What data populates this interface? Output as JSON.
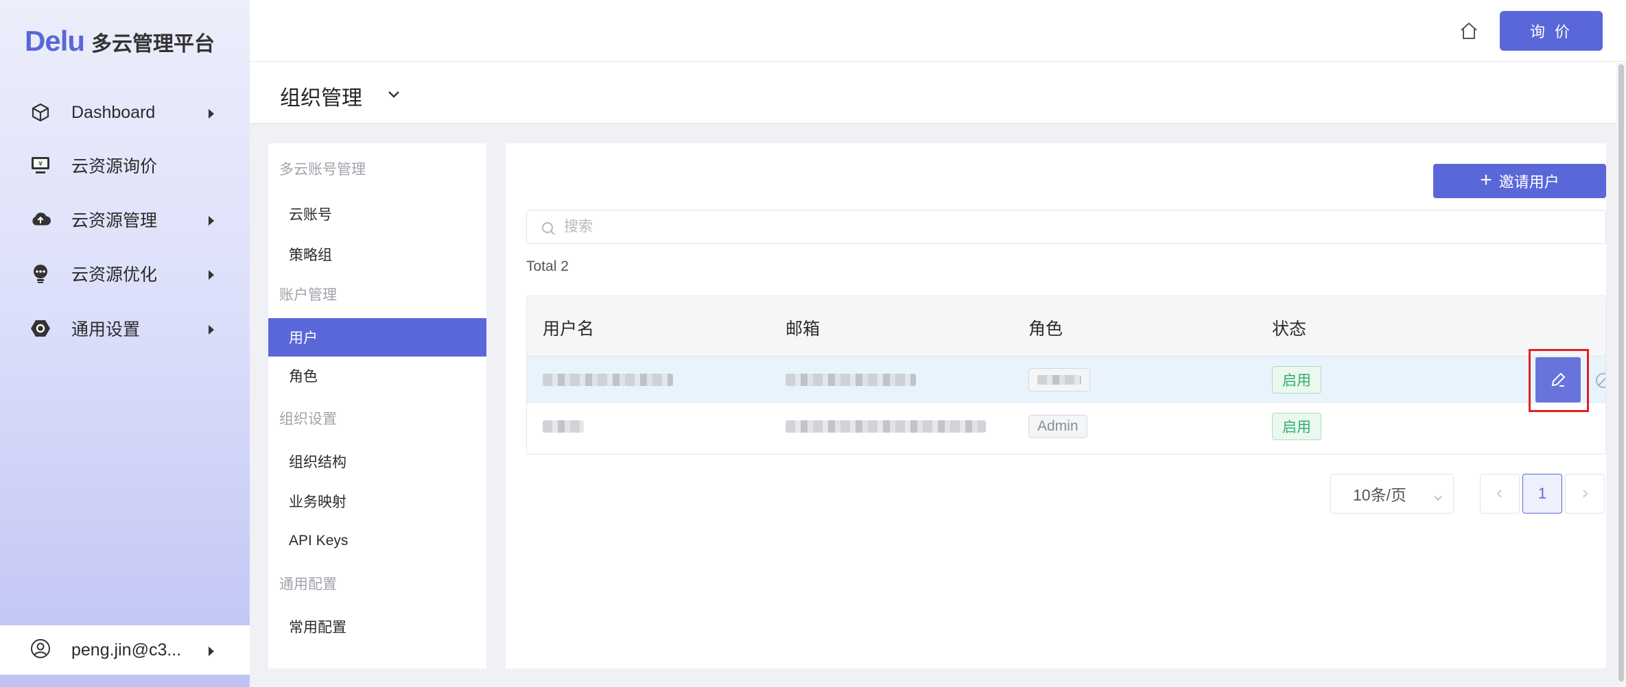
{
  "app": {
    "brand": "Delu",
    "subtitle": "多云管理平台",
    "accent": "#5a67d8"
  },
  "sidebar": {
    "items": [
      {
        "label": "Dashboard",
        "icon": "cube-icon",
        "has_submenu": true
      },
      {
        "label": "云资源询价",
        "icon": "monitor-yen-icon",
        "has_submenu": false
      },
      {
        "label": "云资源管理",
        "icon": "cloud-upload-icon",
        "has_submenu": true
      },
      {
        "label": "云资源优化",
        "icon": "lightbulb-chat-icon",
        "has_submenu": true
      },
      {
        "label": "通用设置",
        "icon": "hexagon-settings-icon",
        "has_submenu": true
      }
    ],
    "user": {
      "label": "peng.jin@c3...",
      "icon": "user-circle-icon"
    }
  },
  "topbar": {
    "home_icon": "home-icon",
    "quote_label": "询 价"
  },
  "subheader": {
    "title": "组织管理"
  },
  "menu": {
    "groups": [
      {
        "title": "多云账号管理",
        "items": [
          "云账号",
          "策略组"
        ]
      },
      {
        "title": "账户管理",
        "items": [
          "用户",
          "角色"
        ]
      },
      {
        "title": "组织设置",
        "items": [
          "组织结构",
          "业务映射",
          "API Keys"
        ]
      },
      {
        "title": "通用配置",
        "items": [
          "常用配置"
        ]
      }
    ],
    "active_item": "用户"
  },
  "content": {
    "invite_label": "邀请用户",
    "search_placeholder": "搜索",
    "total_text": "Total 2",
    "table": {
      "columns": [
        "用户名",
        "邮箱",
        "角色",
        "状态"
      ],
      "rows": [
        {
          "role": "",
          "status": "启用"
        },
        {
          "role": "Admin",
          "status": "启用"
        }
      ]
    },
    "pagination": {
      "page_size": "10条/页",
      "current_page": "1"
    }
  }
}
